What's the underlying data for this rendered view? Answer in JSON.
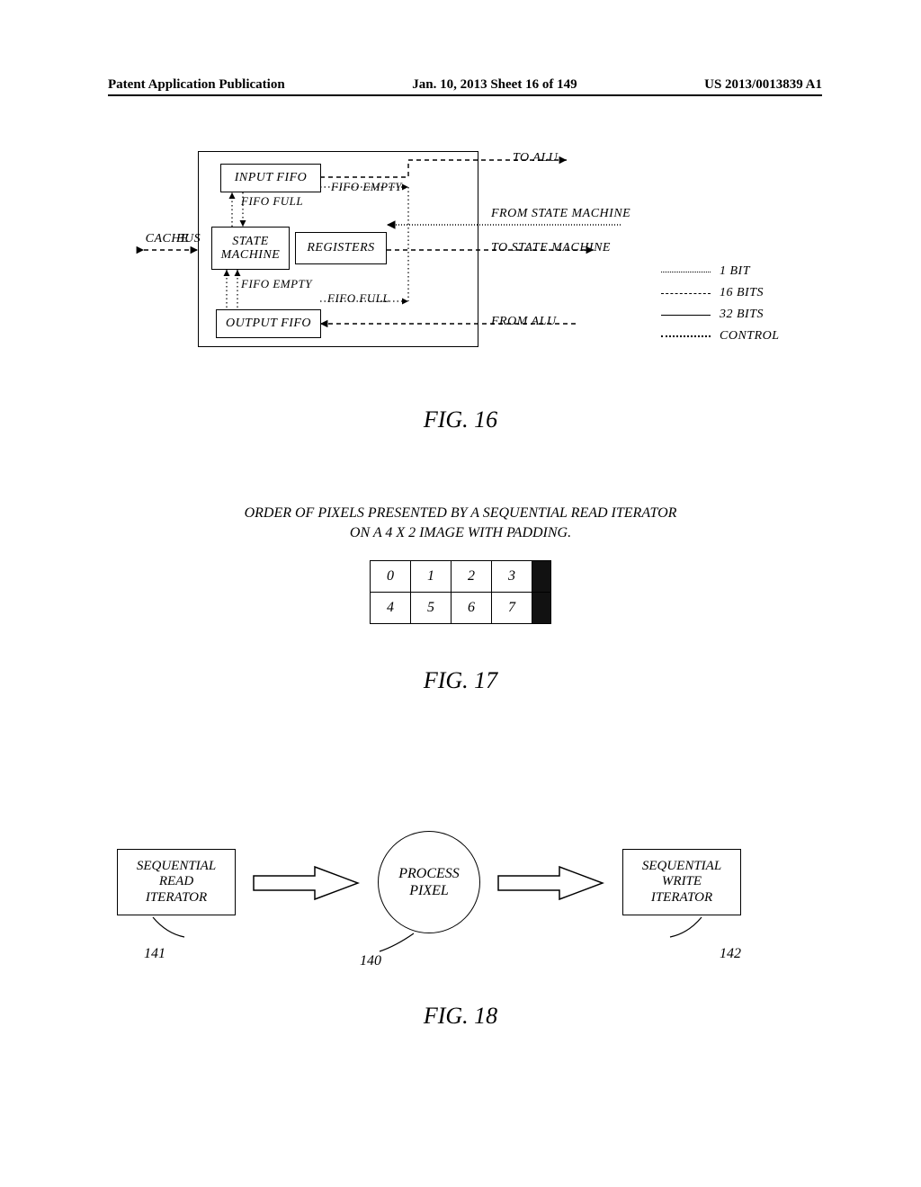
{
  "header": {
    "left": "Patent Application Publication",
    "center": "Jan. 10, 2013  Sheet 16 of 149",
    "right": "US 2013/0013839 A1"
  },
  "fig16": {
    "label": "FIG. 16",
    "cache_bus": "CACHE BUS",
    "input_fifo": "INPUT FIFO",
    "output_fifo": "OUTPUT FIFO",
    "state_machine": "STATE\nMACHINE",
    "registers": "REGISTERS",
    "fifo_full_top": "FIFO FULL",
    "fifo_empty_top": "FIFO EMPTY",
    "fifo_empty_bot": "FIFO EMPTY",
    "fifo_full_bot": "FIFO FULL",
    "to_alu": "TO ALU",
    "from_sm": "FROM STATE MACHINE",
    "to_sm": "TO STATE MACHINE",
    "from_alu": "FROM ALU",
    "legend": {
      "bit1": "1 BIT",
      "bit16": "16 BITS",
      "bit32": "32 BITS",
      "control": "CONTROL"
    }
  },
  "fig17": {
    "caption_line1": "ORDER OF PIXELS PRESENTED BY A SEQUENTIAL READ ITERATOR",
    "caption_line2": "ON A 4 X 2 IMAGE WITH PADDING.",
    "cells": [
      "0",
      "1",
      "2",
      "3",
      "4",
      "5",
      "6",
      "7"
    ],
    "label": "FIG. 17"
  },
  "fig18": {
    "label": "FIG. 18",
    "seq_read": "SEQUENTIAL\nREAD\nITERATOR",
    "process": "PROCESS\nPIXEL",
    "seq_write": "SEQUENTIAL\nWRITE\nITERATOR",
    "ref_left": "141",
    "ref_mid": "140",
    "ref_right": "142"
  }
}
